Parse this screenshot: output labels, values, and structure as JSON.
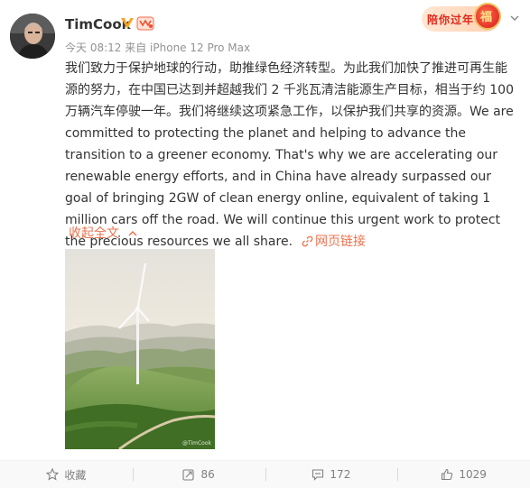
{
  "user": {
    "name": "TimCook",
    "timestamp": "今天 08:12",
    "source": "来自 iPhone 12 Pro Max"
  },
  "promo": {
    "label": "陪你过年",
    "badge": "福"
  },
  "post": {
    "text": "我们致力于保护地球的行动，助推绿色经济转型。为此我们加快了推进可再生能源的努力，在中国已达到并超越我们 2 千兆瓦清洁能源生产目标，相当于约 100 万辆汽车停驶一年。我们将继续这项紧急工作，以保护我们共享的资源。We are committed to protecting the planet and helping to advance the transition to a greener economy. That's why we are accelerating our renewable energy efforts, and in China have already surpassed our goal of bringing 2GW of clean energy online, equivalent of taking 1 million cars off the road. We will continue this urgent work to protect the precious resources we all share.",
    "link_label": "网页链接",
    "collapse_label": "收起全文"
  },
  "image": {
    "watermark": "@TimCook"
  },
  "actions": {
    "favorite_label": "收藏",
    "repost_count": "86",
    "comment_count": "172",
    "like_count": "1029"
  },
  "colors": {
    "accent": "#eb7350",
    "meta_text": "#939393",
    "verified": "#f5a623"
  }
}
